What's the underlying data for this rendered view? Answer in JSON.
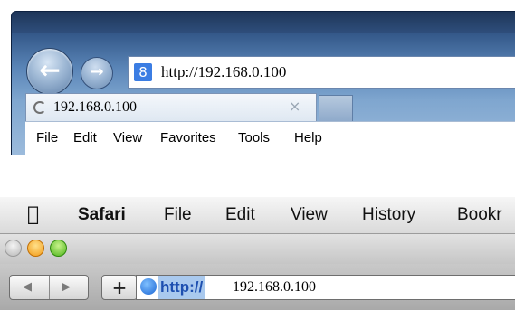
{
  "ie": {
    "address_url": "http://192.168.0.100",
    "tab_title": "192.168.0.100",
    "tab_close": "×",
    "menu": [
      "File",
      "Edit",
      "View",
      "Favorites",
      "Tools",
      "Help"
    ],
    "icons": {
      "back": "arrow-left",
      "forward": "arrow-right",
      "search_provider": "google-g",
      "tab_loading": "loading-spinner"
    }
  },
  "safari": {
    "menubar": [
      "Safari",
      "File",
      "Edit",
      "View",
      "History",
      "Bookr"
    ],
    "address_scheme": "http://",
    "address_host": "192.168.0.100",
    "plus_label": "+",
    "colors": {
      "close_light": "#c8c8c8",
      "minimize_light": "#f29a17",
      "zoom_light": "#4fb51d",
      "url_highlight": "#a9c9ee"
    },
    "icons": {
      "apple": "apple-logo",
      "globe": "globe",
      "back": "triangle-left",
      "forward": "triangle-right"
    }
  }
}
